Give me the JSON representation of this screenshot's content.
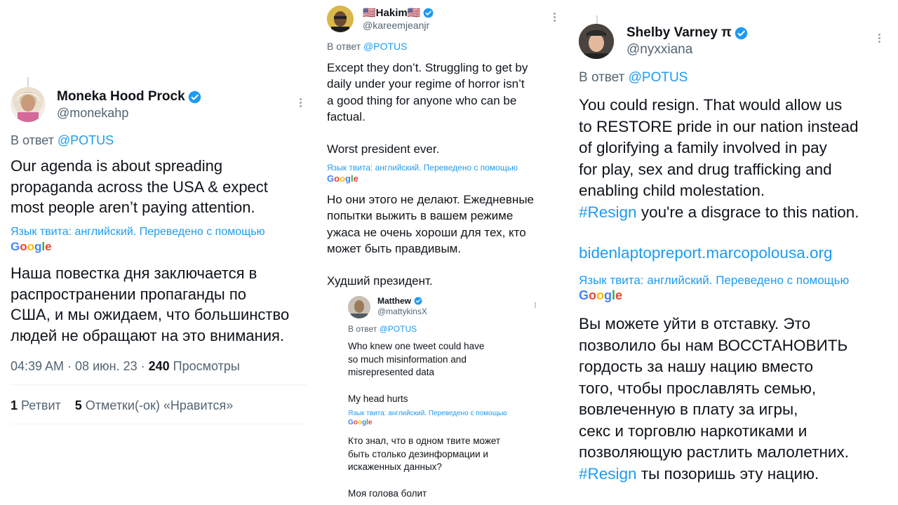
{
  "google_logo": [
    "G",
    "o",
    "o",
    "g",
    "l",
    "e"
  ],
  "panel1": {
    "name": "Moneka Hood Prock",
    "handle": "@monekahp",
    "reply_prefix": "В ответ",
    "reply_mention": "@POTUS",
    "text_original": "Our agenda is about spreading\npropaganda across the USA & expect\nmost people aren’t paying attention.",
    "translation_note": "Язык твита: английский. Переведено с помощью",
    "text_translated": "Наша повестка дня заключается в\nраспространении пропаганды по\nСША, и мы ожидаем, что большинство\nлюдей не обращают на это внимания.",
    "time": "04:39 AM · 08 июн. 23 · ",
    "views_count": "240",
    "views_label": " Просмотры",
    "retweets_count": "1",
    "retweets_label": " Ретвит",
    "likes_count": "5",
    "likes_label": " Отметки(-ок) «Нравится»"
  },
  "panel2": {
    "name": "🇺🇸Hakim🇺🇸",
    "handle": "@kareemjeanjr",
    "reply_prefix": "В ответ",
    "reply_mention": "@POTUS",
    "text_original": "Except they don’t. Struggling to get by\ndaily under your regime of horror isn’t\na good thing for anyone who can be\nfactual.\n\nWorst president ever.",
    "translation_note": "Язык твита: английский. Переведено с помощью",
    "text_translated": "Но они этого не делают. Ежедневные\nпопытки выжить в вашем режиме\nужаса не очень хороши для тех, кто\nможет быть правдивым.\n\nХудший президент.",
    "quote": {
      "name": "Matthew",
      "handle": "@mattykinsX",
      "reply_prefix": "В ответ",
      "reply_mention": "@POTUS",
      "text_original": "Who knew one tweet could have\nso much misinformation and\nmisrepresented data\n\nMy head hurts",
      "translation_note": "Язык твита: английский. Переведено с помощью",
      "text_translated": "Кто знал, что в одном твите может\nбыть столько дезинформации и\nискаженных данных?\n\nМоя голова болит"
    }
  },
  "panel3": {
    "name": "Shelby Varney π",
    "handle": "@nyxxiana",
    "reply_prefix": "В ответ",
    "reply_mention": "@POTUS",
    "text_original": "You could resign. That would allow us\nto RESTORE pride in our nation instead\nof glorifying a family involved in pay\nfor play, sex and drug trafficking and\nenabling child molestation.",
    "hashtag": "#Resign",
    "text_original_tail": " you're a disgrace to this nation.",
    "link": "bidenlaptopreport.marcopolousa.org",
    "translation_note": "Язык твита: английский. Переведено с помощью",
    "text_translated": "Вы можете уйти в отставку. Это\nпозволило бы нам ВОССТАНОВИТЬ\nгордость за нашу нацию вместо\nтого, чтобы прославлять семью,\nвовлеченную в плату за игры,\nсекс и торговлю наркотиками и\nпозволяющую растлить малолетних.",
    "hashtag_translated": "#Resign",
    "text_translated_tail": " ты позоришь эту нацию."
  },
  "colors": {
    "link_blue": "#1d9bf0",
    "muted": "#536471",
    "text": "#0f1419"
  }
}
